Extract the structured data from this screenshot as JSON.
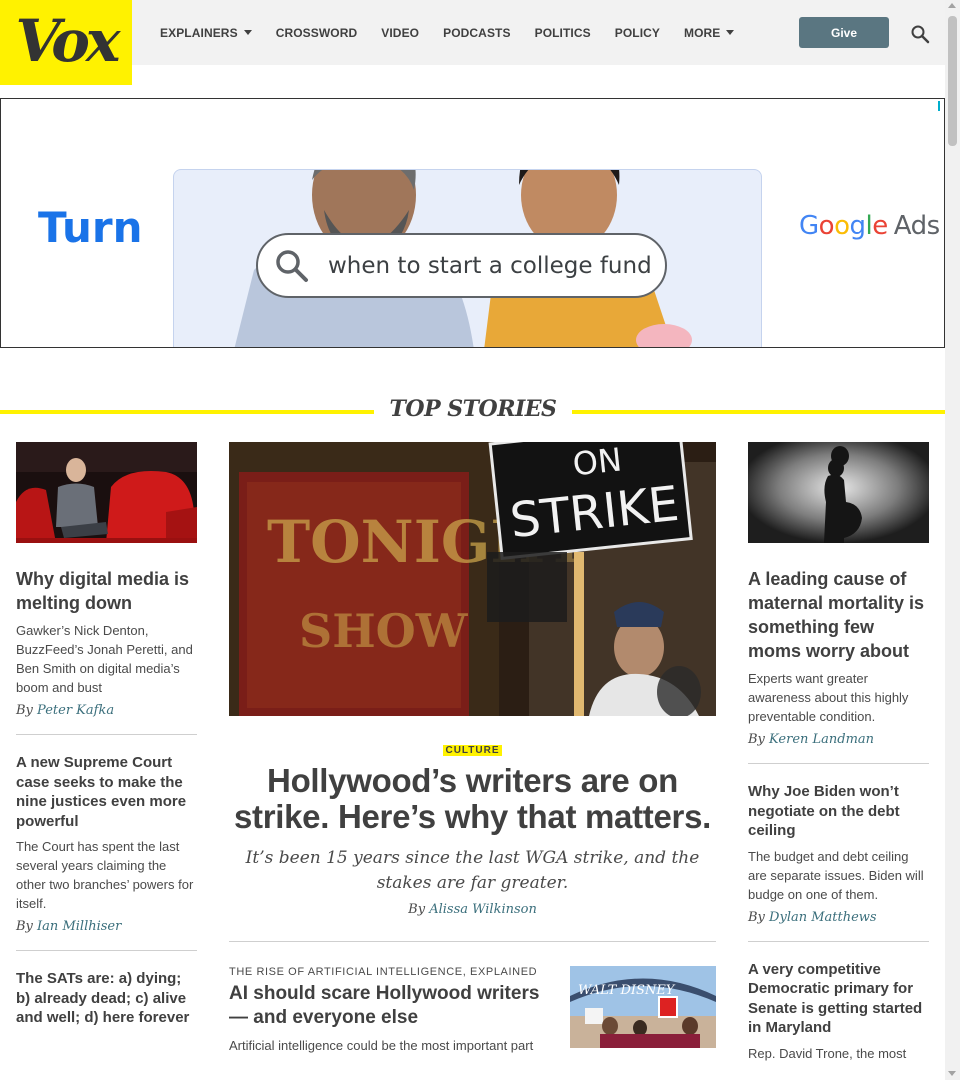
{
  "header": {
    "logo": "Vox",
    "nav": [
      {
        "label": "EXPLAINERS",
        "has_dropdown": true
      },
      {
        "label": "CROSSWORD",
        "has_dropdown": false
      },
      {
        "label": "VIDEO",
        "has_dropdown": false
      },
      {
        "label": "PODCASTS",
        "has_dropdown": false
      },
      {
        "label": "POLITICS",
        "has_dropdown": false
      },
      {
        "label": "POLICY",
        "has_dropdown": false
      },
      {
        "label": "MORE",
        "has_dropdown": true
      }
    ],
    "give_label": "Give",
    "search_icon": "search-icon"
  },
  "ad": {
    "headline": "Turn",
    "search_query": "when to start a college fund",
    "brand": "Google",
    "brand_suffix": "Ads"
  },
  "section_title": "TOP STORIES",
  "left_column": [
    {
      "headline": "Why digital media is melting down",
      "dek": "Gawker’s Nick Denton, BuzzFeed’s Jonah Peretti, and Ben Smith on digital media’s boom and bust",
      "by": "By",
      "author": "Peter Kafka"
    },
    {
      "headline": "A new Supreme Court case seeks to make the nine justices even more powerful",
      "dek": "The Court has spent the last several years claiming the other two branches’ powers for itself.",
      "by": "By",
      "author": "Ian Millhiser"
    },
    {
      "headline": "The SATs are: a) dying; b) already dead; c) alive and well; d) here forever"
    }
  ],
  "feature": {
    "kicker": "CULTURE",
    "headline": "Hollywood’s writers are on strike. Here’s why that matters.",
    "dek": "It’s been 15 years since the last WGA strike, and the stakes are far greater.",
    "by": "By",
    "author": "Alissa Wilkinson",
    "image_sign_1": "ON",
    "image_sign_2": "STRIKE",
    "image_sign_3": "TONIGHT",
    "image_sign_4": "SHOW"
  },
  "sub_story": {
    "eyebrow": "THE RISE OF ARTIFICIAL INTELLIGENCE, EXPLAINED",
    "headline": "AI should scare Hollywood writers — and everyone else",
    "dek": "Artificial intelligence could be the most important part"
  },
  "right_column": [
    {
      "headline": "A leading cause of maternal mortality is something few moms worry about",
      "dek": "Experts want greater awareness about this highly preventable condition.",
      "by": "By",
      "author": "Keren Landman"
    },
    {
      "headline": "Why Joe Biden won’t negotiate on the debt ceiling",
      "dek": "The budget and debt ceiling are separate issues. Biden will budge on one of them.",
      "by": "By",
      "author": "Dylan Matthews"
    },
    {
      "headline": "A very competitive Democratic primary for Senate is getting started in Maryland",
      "dek": "Rep. David Trone, the most"
    }
  ],
  "colors": {
    "brand_yellow": "#fff200",
    "give_button": "#5a7681",
    "author_link": "#3b6f7c",
    "google_blue": "#1a73e8"
  }
}
